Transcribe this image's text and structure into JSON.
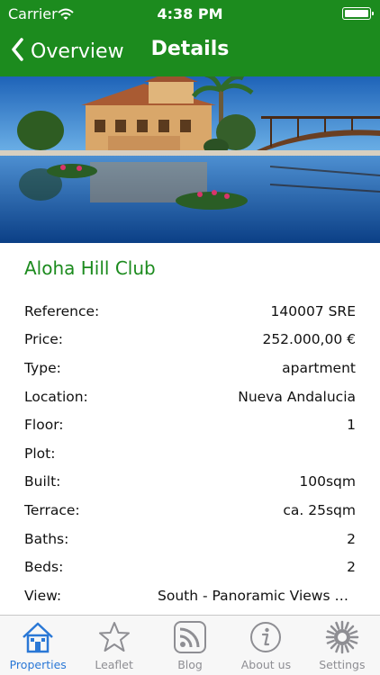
{
  "status_bar": {
    "carrier": "Carrier",
    "time": "4:38 PM"
  },
  "nav": {
    "back_label": "Overview",
    "title": "Details"
  },
  "hero_image": {
    "description": "villa with pool and palm trees"
  },
  "property": {
    "title": "Aloha Hill Club",
    "details": [
      {
        "label": "Reference:",
        "value": "140007 SRE"
      },
      {
        "label": "Price:",
        "value": "252.000,00 €"
      },
      {
        "label": "Type:",
        "value": "apartment"
      },
      {
        "label": "Location:",
        "value": "Nueva Andalucia"
      },
      {
        "label": "Floor:",
        "value": "1"
      },
      {
        "label": "Plot:",
        "value": ""
      },
      {
        "label": "Built:",
        "value": "100sqm"
      },
      {
        "label": "Terrace:",
        "value": "ca. 25sqm"
      },
      {
        "label": "Baths:",
        "value": "2"
      },
      {
        "label": "Beds:",
        "value": "2"
      },
      {
        "label": "View:",
        "value": "South - Panoramic Views o…"
      }
    ]
  },
  "tabs": [
    {
      "label": "Properties",
      "icon": "house-icon",
      "active": true
    },
    {
      "label": "Leaflet",
      "icon": "star-icon",
      "active": false
    },
    {
      "label": "Blog",
      "icon": "rss-icon",
      "active": false
    },
    {
      "label": "About us",
      "icon": "info-icon",
      "active": false
    },
    {
      "label": "Settings",
      "icon": "gear-icon",
      "active": false
    }
  ],
  "colors": {
    "nav_green": "#1c8b1e",
    "title_green": "#1c8b1e",
    "tab_active": "#2a78d6",
    "tab_inactive": "#8e8e93"
  }
}
